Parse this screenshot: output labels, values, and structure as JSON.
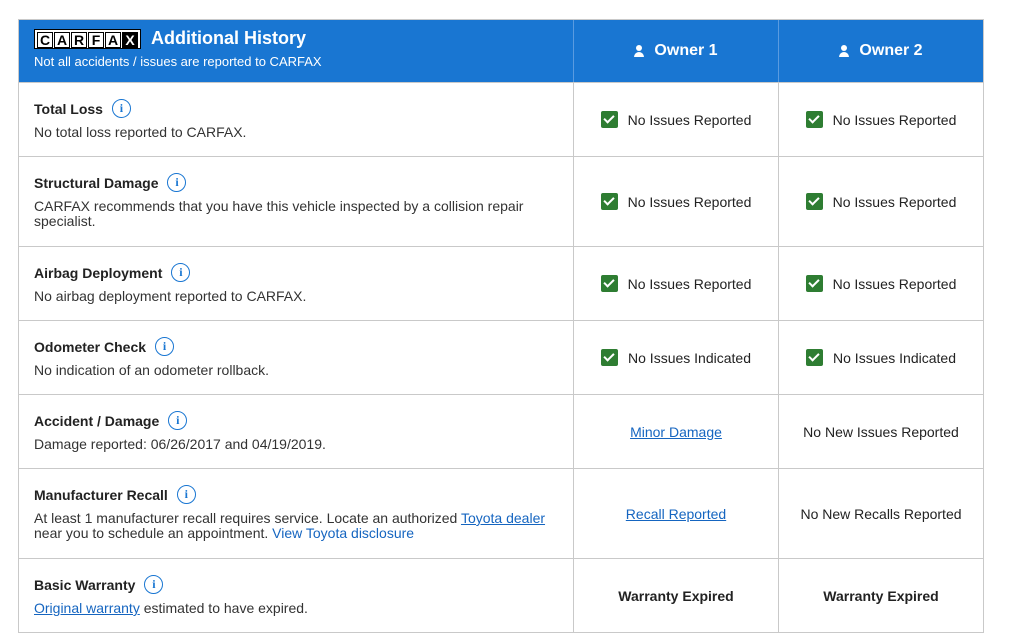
{
  "header": {
    "logo_text": "CARFAX",
    "title": "Additional History",
    "subtitle": "Not all accidents / issues are reported to CARFAX",
    "owner1": "Owner 1",
    "owner2": "Owner 2"
  },
  "rows": [
    {
      "title": "Total Loss",
      "desc": "No total loss reported to CARFAX.",
      "owner1": "No Issues Reported",
      "owner2": "No Issues Reported"
    },
    {
      "title": "Structural Damage",
      "desc": "CARFAX recommends that you have this vehicle inspected by a collision repair specialist.",
      "owner1": "No Issues Reported",
      "owner2": "No Issues Reported"
    },
    {
      "title": "Airbag Deployment",
      "desc": "No airbag deployment reported to CARFAX.",
      "owner1": "No Issues Reported",
      "owner2": "No Issues Reported"
    },
    {
      "title": "Odometer Check",
      "desc": "No indication of an odometer rollback.",
      "owner1": "No Issues Indicated",
      "owner2": "No Issues Indicated"
    },
    {
      "title": "Accident / Damage",
      "desc": "Damage reported: 06/26/2017 and 04/19/2019.",
      "owner1": "Minor Damage",
      "owner2": "No New Issues Reported"
    },
    {
      "title": "Manufacturer Recall",
      "desc_pre": "At least 1 manufacturer recall requires service. Locate an authorized ",
      "desc_link": "Toyota dealer",
      "desc_mid": " near you to schedule an appointment. ",
      "desc_link2": "View Toyota disclosure",
      "owner1": "Recall Reported",
      "owner2": "No New Recalls Reported"
    },
    {
      "title": "Basic Warranty",
      "desc_link": "Original warranty",
      "desc_post": " estimated to have expired.",
      "owner1": "Warranty Expired",
      "owner2": "Warranty Expired"
    }
  ]
}
